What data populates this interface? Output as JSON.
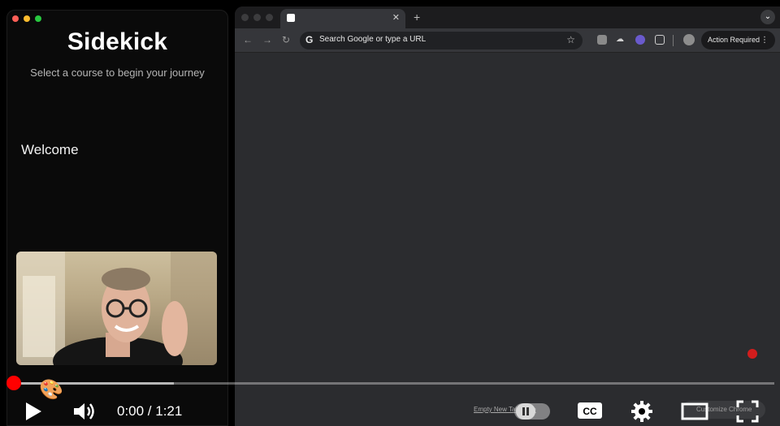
{
  "app": {
    "title": "Sidekick",
    "subtitle": "Select a course to begin your journey",
    "section_title": "Welcome"
  },
  "browser": {
    "omnibox_placeholder": "Search Google or type a URL",
    "action_button_label": "Action Required",
    "ntp_link": "Empty New Tab Page",
    "customize_label": "Customize Chrome"
  },
  "player": {
    "time_display": "0:00 / 1:21",
    "progress_played": 0.01,
    "progress_loaded": 0.21
  },
  "colors": {
    "accent": "#ff0000",
    "recording_dot": "#d21d1d"
  }
}
